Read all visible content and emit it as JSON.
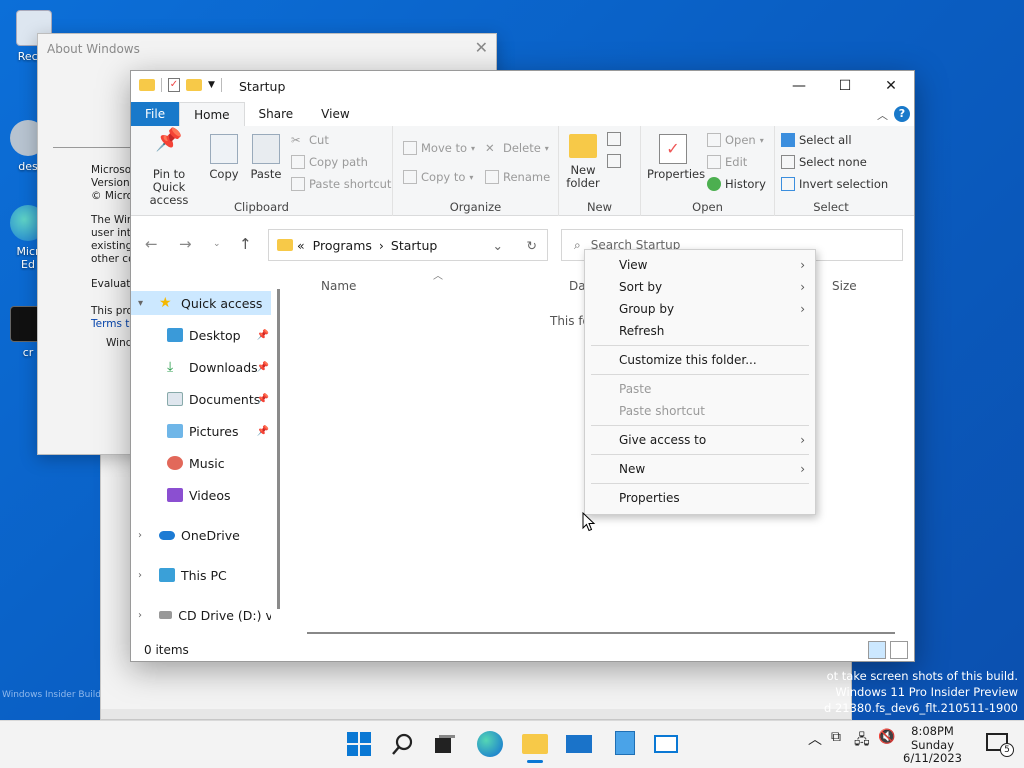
{
  "desktop": {
    "icons": [
      {
        "label": "Recyc"
      },
      {
        "label": "des"
      },
      {
        "label": "Micr\nEd"
      },
      {
        "label": "cr"
      }
    ],
    "watermark_lines": [
      "ot take screen shots of this build.",
      "Windows 11 Pro Insider Preview",
      "d 21380.fs_dev6_flt.210511-1900"
    ],
    "insider_text": "Windows Insider Build"
  },
  "about_window": {
    "title": "About Windows",
    "lines": [
      "Microsof",
      "Version",
      "© Micro",
      "",
      "The Win",
      "user inte",
      "existing",
      "other co",
      "",
      "Evaluati",
      "",
      "This pro",
      "Terms to",
      "",
      "Wind"
    ]
  },
  "explorer": {
    "title": "Startup",
    "ribbon_tabs": [
      "File",
      "Home",
      "Share",
      "View"
    ],
    "groups": {
      "clipboard": {
        "label": "Clipboard",
        "pin": "Pin to Quick access",
        "copy": "Copy",
        "paste": "Paste",
        "cut": "Cut",
        "copy_path": "Copy path",
        "paste_shortcut": "Paste shortcut"
      },
      "organize": {
        "label": "Organize",
        "move_to": "Move to",
        "copy_to": "Copy to",
        "delete": "Delete",
        "rename": "Rename"
      },
      "new": {
        "label": "New",
        "new_folder": "New folder"
      },
      "open": {
        "label": "Open",
        "properties": "Properties",
        "open": "Open",
        "edit": "Edit",
        "history": "History"
      },
      "select": {
        "label": "Select",
        "select_all": "Select all",
        "select_none": "Select none",
        "invert": "Invert selection"
      }
    },
    "address": {
      "prefix": "«",
      "crumbs": [
        "Programs",
        "Startup"
      ]
    },
    "search_placeholder": "Search Startup",
    "nav": {
      "quick_access": "Quick access",
      "desktop": "Desktop",
      "downloads": "Downloads",
      "documents": "Documents",
      "pictures": "Pictures",
      "music": "Music",
      "videos": "Videos",
      "onedrive": "OneDrive",
      "thispc": "This PC",
      "cddrive": "CD Drive (D:) virti"
    },
    "columns": {
      "name": "Name",
      "date": "Dat",
      "size": "Size"
    },
    "empty_text": "This fo",
    "status": "0 items"
  },
  "context_menu": {
    "view": "View",
    "sort_by": "Sort by",
    "group_by": "Group by",
    "refresh": "Refresh",
    "customize": "Customize this folder...",
    "paste": "Paste",
    "paste_shortcut": "Paste shortcut",
    "give_access": "Give access to",
    "new": "New",
    "properties": "Properties"
  },
  "taskbar": {
    "time": "8:08PM",
    "day": "Sunday",
    "date": "6/11/2023",
    "notif_count": "5"
  },
  "colors": {
    "accent": "#1979ca",
    "selection": "#cce8ff",
    "folder": "#f7c948"
  }
}
